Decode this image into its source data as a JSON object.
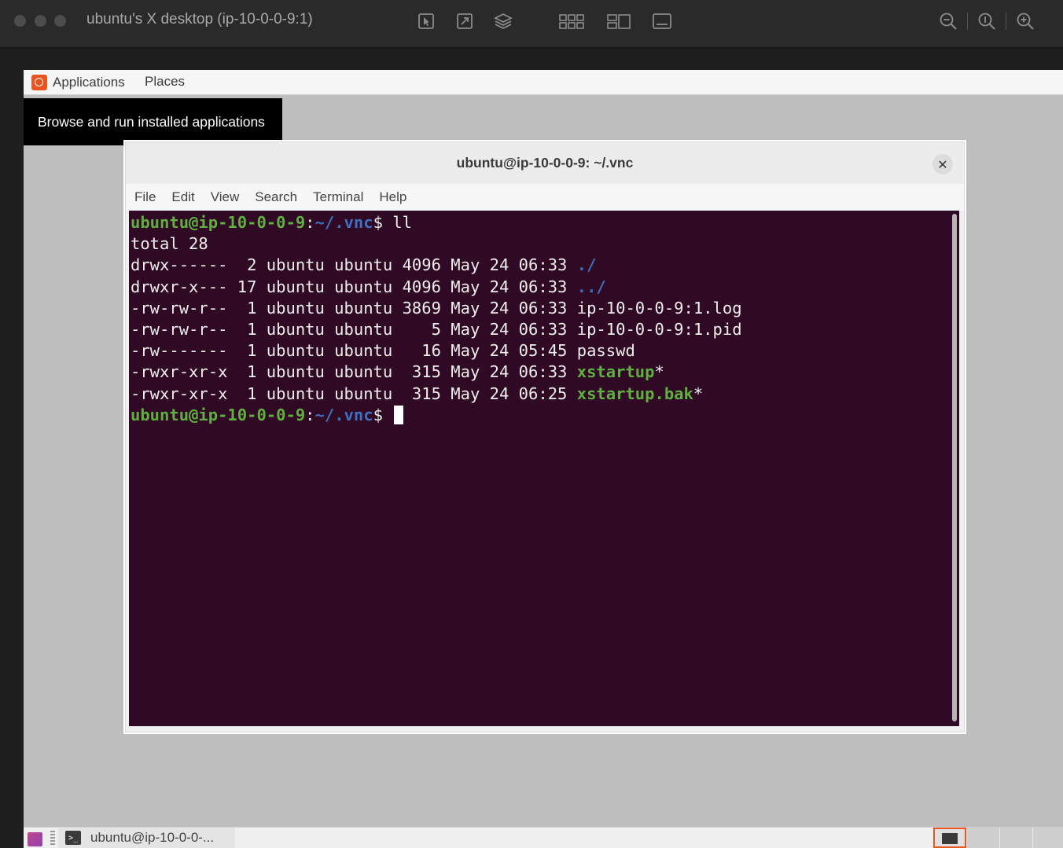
{
  "viewer": {
    "title": "ubuntu's X desktop (ip-10-0-0-9:1)",
    "toolbar_icons": [
      "pointer-icon",
      "scale-icon",
      "layers-icon",
      "grid-icon",
      "split-icon",
      "keyboard-icon",
      "zoom-out-icon",
      "zoom-fit-icon",
      "zoom-in-icon"
    ]
  },
  "panel": {
    "applications": "Applications",
    "places": "Places",
    "tooltip": "Browse and run installed applications"
  },
  "terminal": {
    "title": "ubuntu@ip-10-0-0-9: ~/.vnc",
    "menu": [
      "File",
      "Edit",
      "View",
      "Search",
      "Terminal",
      "Help"
    ],
    "prompt_user": "ubuntu@ip-10-0-0-9",
    "prompt_path": "~/.vnc",
    "command": "ll",
    "total": "total 28",
    "entries": [
      {
        "meta": "drwx------  2 ubuntu ubuntu 4096 May 24 06:33 ",
        "name": "./",
        "kind": "dir"
      },
      {
        "meta": "drwxr-x--- 17 ubuntu ubuntu 4096 May 24 06:33 ",
        "name": "../",
        "kind": "dir"
      },
      {
        "meta": "-rw-rw-r--  1 ubuntu ubuntu 3869 May 24 06:33 ",
        "name": "ip-10-0-0-9:1.log",
        "kind": "file"
      },
      {
        "meta": "-rw-rw-r--  1 ubuntu ubuntu    5 May 24 06:33 ",
        "name": "ip-10-0-0-9:1.pid",
        "kind": "file"
      },
      {
        "meta": "-rw-------  1 ubuntu ubuntu   16 May 24 05:45 ",
        "name": "passwd",
        "kind": "file"
      },
      {
        "meta": "-rwxr-xr-x  1 ubuntu ubuntu  315 May 24 06:33 ",
        "name": "xstartup",
        "kind": "exec"
      },
      {
        "meta": "-rwxr-xr-x  1 ubuntu ubuntu  315 May 24 06:25 ",
        "name": "xstartup.bak",
        "kind": "exec"
      }
    ]
  },
  "taskbar": {
    "task_label": "ubuntu@ip-10-0-0-..."
  }
}
